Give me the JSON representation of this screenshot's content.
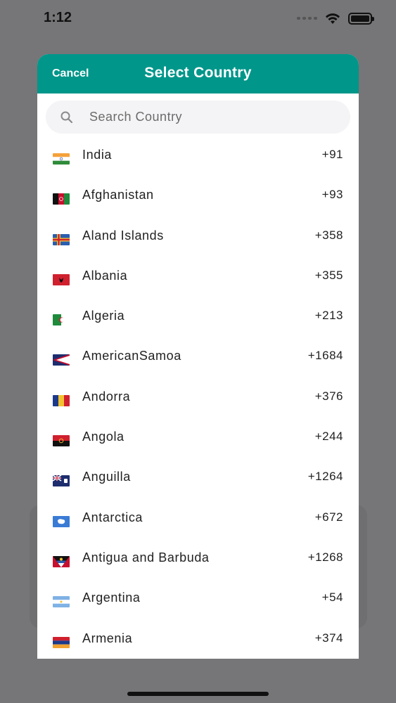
{
  "status_bar": {
    "time": "1:12",
    "icons": [
      "cellular-icon",
      "wifi-icon",
      "battery-icon"
    ]
  },
  "modal": {
    "cancel_label": "Cancel",
    "title": "Select Country",
    "search_placeholder": "Search Country",
    "search_value": "",
    "header_color": "#00968a"
  },
  "countries": [
    {
      "name": "India",
      "code": "+91",
      "flag": "india-flag-icon"
    },
    {
      "name": "Afghanistan",
      "code": "+93",
      "flag": "afghanistan-flag-icon"
    },
    {
      "name": "Aland Islands",
      "code": "+358",
      "flag": "aland-islands-flag-icon"
    },
    {
      "name": "Albania",
      "code": "+355",
      "flag": "albania-flag-icon"
    },
    {
      "name": "Algeria",
      "code": "+213",
      "flag": "algeria-flag-icon"
    },
    {
      "name": "AmericanSamoa",
      "code": "+1684",
      "flag": "american-samoa-flag-icon"
    },
    {
      "name": "Andorra",
      "code": "+376",
      "flag": "andorra-flag-icon"
    },
    {
      "name": "Angola",
      "code": "+244",
      "flag": "angola-flag-icon"
    },
    {
      "name": "Anguilla",
      "code": "+1264",
      "flag": "anguilla-flag-icon"
    },
    {
      "name": "Antarctica",
      "code": "+672",
      "flag": "antarctica-flag-icon"
    },
    {
      "name": "Antigua and Barbuda",
      "code": "+1268",
      "flag": "antigua-barbuda-flag-icon"
    },
    {
      "name": "Argentina",
      "code": "+54",
      "flag": "argentina-flag-icon"
    },
    {
      "name": "Armenia",
      "code": "+374",
      "flag": "armenia-flag-icon"
    }
  ]
}
